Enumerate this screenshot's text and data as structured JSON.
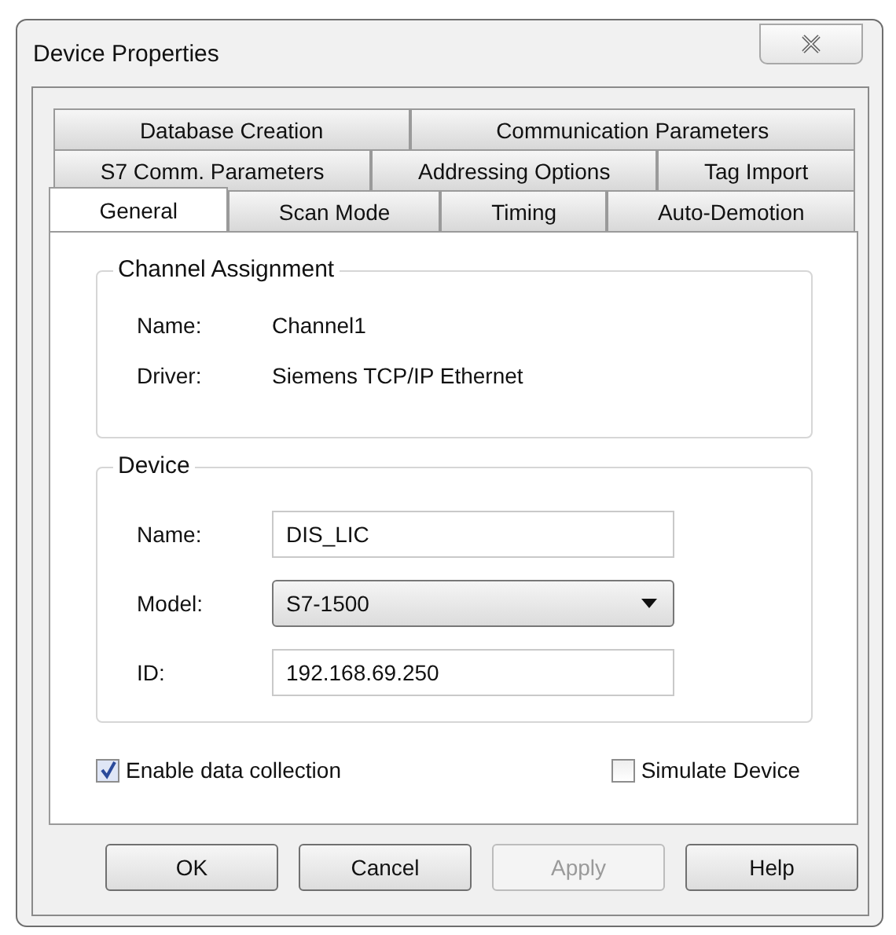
{
  "window": {
    "title": "Device Properties"
  },
  "tab_rows": [
    [
      {
        "label": "Database Creation",
        "selected": false
      },
      {
        "label": "Communication Parameters",
        "selected": false
      }
    ],
    [
      {
        "label": "S7 Comm. Parameters",
        "selected": false
      },
      {
        "label": "Addressing Options",
        "selected": false
      },
      {
        "label": "Tag Import",
        "selected": false
      }
    ],
    [
      {
        "label": "General",
        "selected": true
      },
      {
        "label": "Scan Mode",
        "selected": false
      },
      {
        "label": "Timing",
        "selected": false
      },
      {
        "label": "Auto-Demotion",
        "selected": false
      }
    ]
  ],
  "channel_assignment": {
    "title": "Channel Assignment",
    "rows": [
      {
        "label": "Name:",
        "value": "Channel1"
      },
      {
        "label": "Driver:",
        "value": "Siemens TCP/IP Ethernet"
      }
    ]
  },
  "device": {
    "title": "Device",
    "fields": [
      {
        "kind": "text",
        "label": "Name:",
        "value": "DIS_LIC"
      },
      {
        "kind": "dropdown",
        "label": "Model:",
        "value": "S7-1500"
      },
      {
        "kind": "text",
        "label": "ID:",
        "value": "192.168.69.250"
      }
    ]
  },
  "checkboxes": [
    {
      "label": "Enable data collection",
      "checked": true
    },
    {
      "label": "Simulate Device",
      "checked": false
    }
  ],
  "buttons": [
    {
      "label": "OK",
      "disabled": false
    },
    {
      "label": "Cancel",
      "disabled": false
    },
    {
      "label": "Apply",
      "disabled": true
    },
    {
      "label": "Help",
      "disabled": false
    }
  ]
}
